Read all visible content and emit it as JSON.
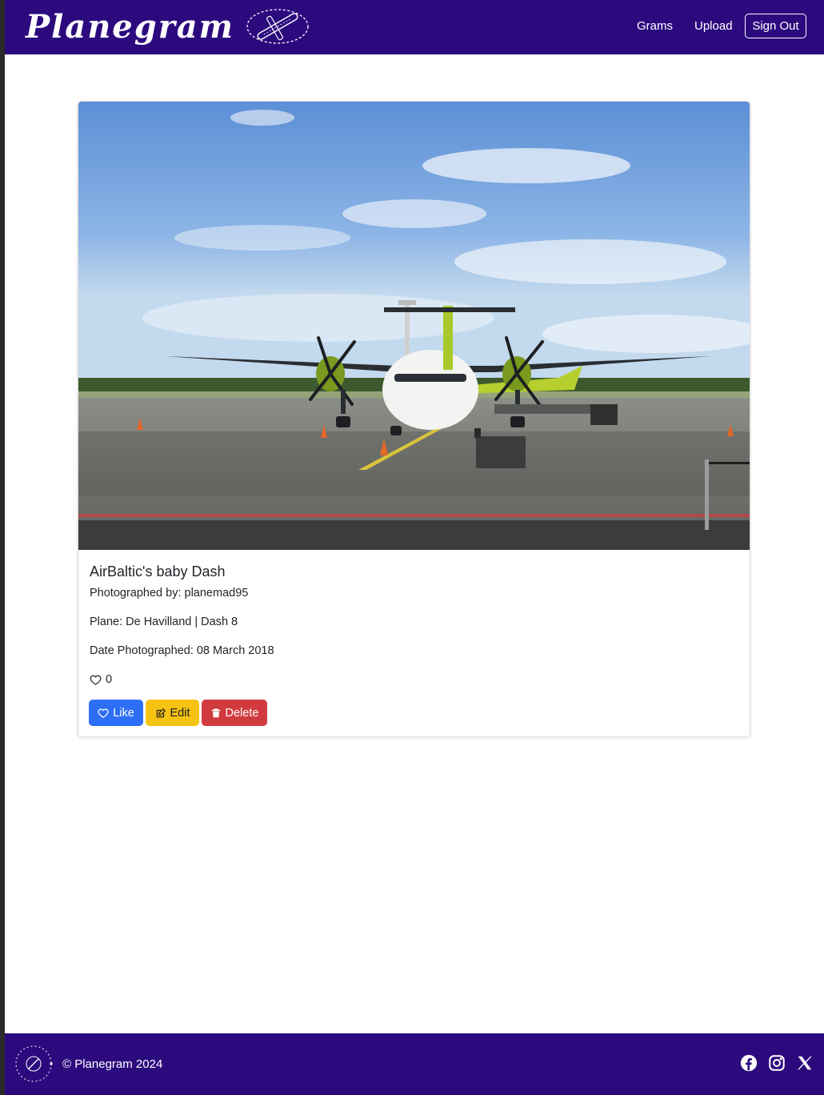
{
  "navbar": {
    "brand": "Planegram",
    "links": [
      {
        "label": "Grams"
      },
      {
        "label": "Upload"
      }
    ],
    "signout_label": "Sign Out"
  },
  "post": {
    "title": "AirBaltic's baby Dash",
    "photographer_line": "Photographed by: planemad95",
    "plane_line": "Plane: De Havilland | Dash 8",
    "date_line": "Date Photographed: 08 March 2018",
    "like_count": "0",
    "buttons": {
      "like": "Like",
      "edit": "Edit",
      "delete": "Delete"
    }
  },
  "footer": {
    "copyright": "© Planegram 2024",
    "social_icons": [
      "facebook-icon",
      "instagram-icon",
      "x-icon"
    ]
  },
  "colors": {
    "brand": "#2c0a7e",
    "like": "#2e6ff7",
    "edit": "#f7c313",
    "delete": "#d13b3f"
  }
}
